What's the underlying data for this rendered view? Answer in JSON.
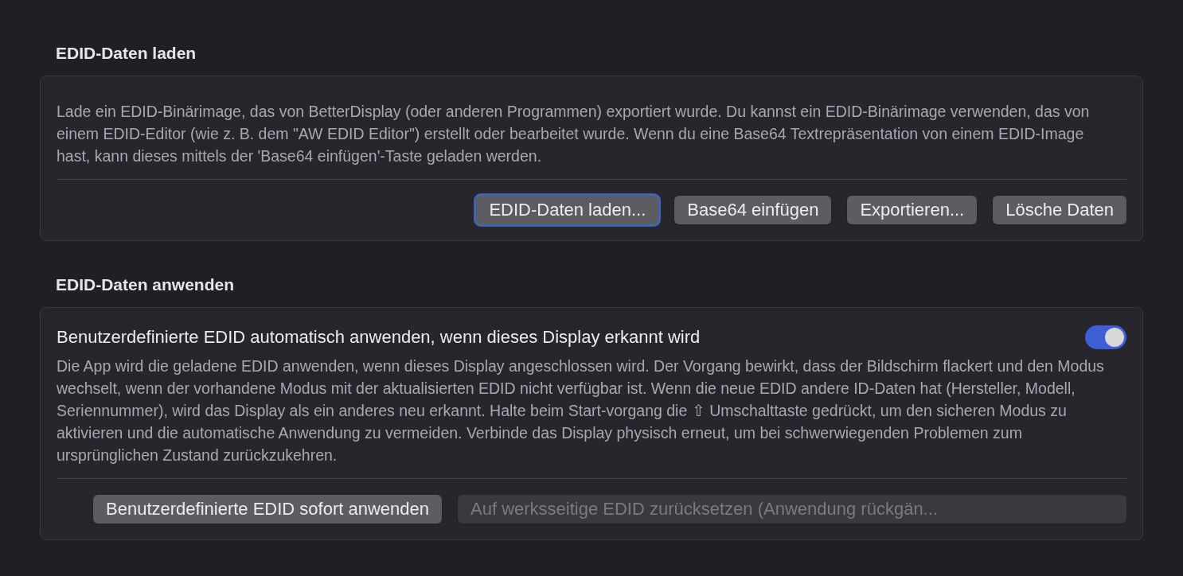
{
  "sections": [
    {
      "heading": "EDID-Daten laden",
      "description": "Lade ein EDID-Binärimage, das von BetterDisplay (oder anderen Programmen) exportiert wurde. Du kannst ein EDID-Binärimage verwenden, das von einem EDID-Editor (wie z. B. dem \"AW EDID Editor\") erstellt oder bearbeitet wurde. Wenn du eine Base64 Textrepräsentation von einem EDID-Image hast, kann dieses mittels der 'Base64 einfügen'-Taste geladen werden.",
      "buttons": [
        {
          "label": "EDID-Daten laden...",
          "focused": true,
          "disabled": false
        },
        {
          "label": "Base64 einfügen",
          "focused": false,
          "disabled": false
        },
        {
          "label": "Exportieren...",
          "focused": false,
          "disabled": false
        },
        {
          "label": "Lösche Daten",
          "focused": false,
          "disabled": false
        }
      ]
    },
    {
      "heading": "EDID-Daten anwenden",
      "option": {
        "label": "Benutzerdefinierte EDID automatisch anwenden, wenn dieses Display erkannt wird",
        "on": true
      },
      "description": "Die App wird die geladene EDID anwenden, wenn dieses Display angeschlossen wird. Der Vorgang bewirkt, dass der Bildschirm flackert und den Modus wechselt, wenn der vorhandene Modus mit der aktualisierten EDID nicht verfügbar ist. Wenn die neue EDID andere ID-Daten hat (Hersteller, Modell, Seriennummer), wird das Display als ein anderes neu erkannt. Halte beim Start-vorgang die ⇧ Umschalttaste gedrückt, um den sicheren Modus zu aktivieren und die automatische Anwendung zu vermeiden. Verbinde das Display physisch erneut, um bei schwerwiegenden Problemen zum ursprünglichen Zustand zurückzukehren.",
      "buttons": [
        {
          "label": "Benutzerdefinierte EDID sofort anwenden",
          "focused": false,
          "disabled": false
        },
        {
          "label": "Auf werksseitige EDID zurücksetzen (Anwendung rückgän...",
          "focused": false,
          "disabled": true
        }
      ]
    }
  ]
}
